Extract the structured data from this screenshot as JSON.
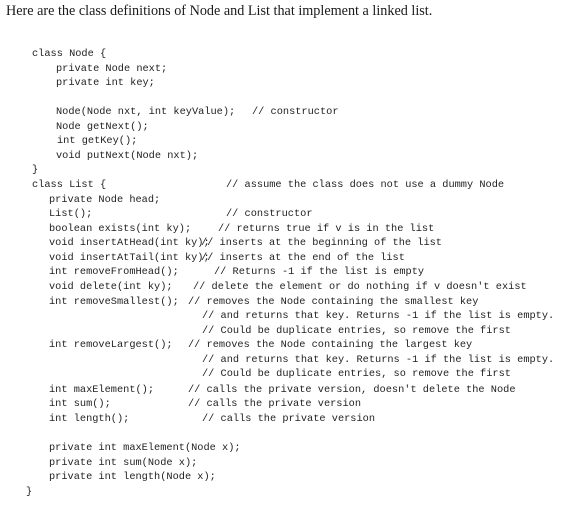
{
  "intro": "Here are the class definitions of Node and List that implement a linked list.",
  "node_class": {
    "header": "class Node {",
    "fields": [
      "private Node next;",
      "private int key;"
    ],
    "constructor": "Node(Node nxt, int keyValue);",
    "constructor_comment": "// constructor",
    "methods": [
      "Node getNext();",
      "int getKey();",
      "void putNext(Node nxt);"
    ],
    "close": "}"
  },
  "list_class": {
    "header": "class List {",
    "header_comment": "// assume the class does not use a dummy Node",
    "members": [
      {
        "code": "private Node head;",
        "comment": ""
      },
      {
        "code": "List();",
        "comment": "// constructor"
      },
      {
        "code": "boolean exists(int ky);",
        "comment": "// returns true if v is in the list"
      },
      {
        "code": "void insertAtHead(int ky);",
        "comment": "// inserts at the beginning of the list"
      },
      {
        "code": "void insertAtTail(int ky);",
        "comment": "// inserts at the end of the list"
      },
      {
        "code": "int removeFromHead();",
        "comment": "// Returns -1 if the list is empty"
      },
      {
        "code": "void delete(int ky);",
        "comment": "// delete the element or do nothing if v doesn't exist"
      },
      {
        "code": "int removeSmallest();",
        "comment": "// removes the Node containing the smallest key"
      },
      {
        "code": "",
        "comment": "// and returns that key. Returns -1 if the list is empty."
      },
      {
        "code": "",
        "comment": "// Could be duplicate entries, so remove the first"
      },
      {
        "code": "int removeLargest();",
        "comment": "// removes the Node containing the largest key"
      },
      {
        "code": "",
        "comment": "// and returns that key. Returns -1 if the list is empty."
      },
      {
        "code": "",
        "comment": "// Could be duplicate entries, so remove the first"
      },
      {
        "code": "int maxElement();",
        "comment": "// calls the private version, doesn't delete the Node"
      },
      {
        "code": "int sum();",
        "comment": "// calls the private version"
      },
      {
        "code": "int length();",
        "comment": "// calls the private version"
      }
    ],
    "private_methods": [
      "private int maxElement(Node x);",
      "private int sum(Node x);",
      "private int length(Node x);"
    ],
    "close": "}"
  }
}
